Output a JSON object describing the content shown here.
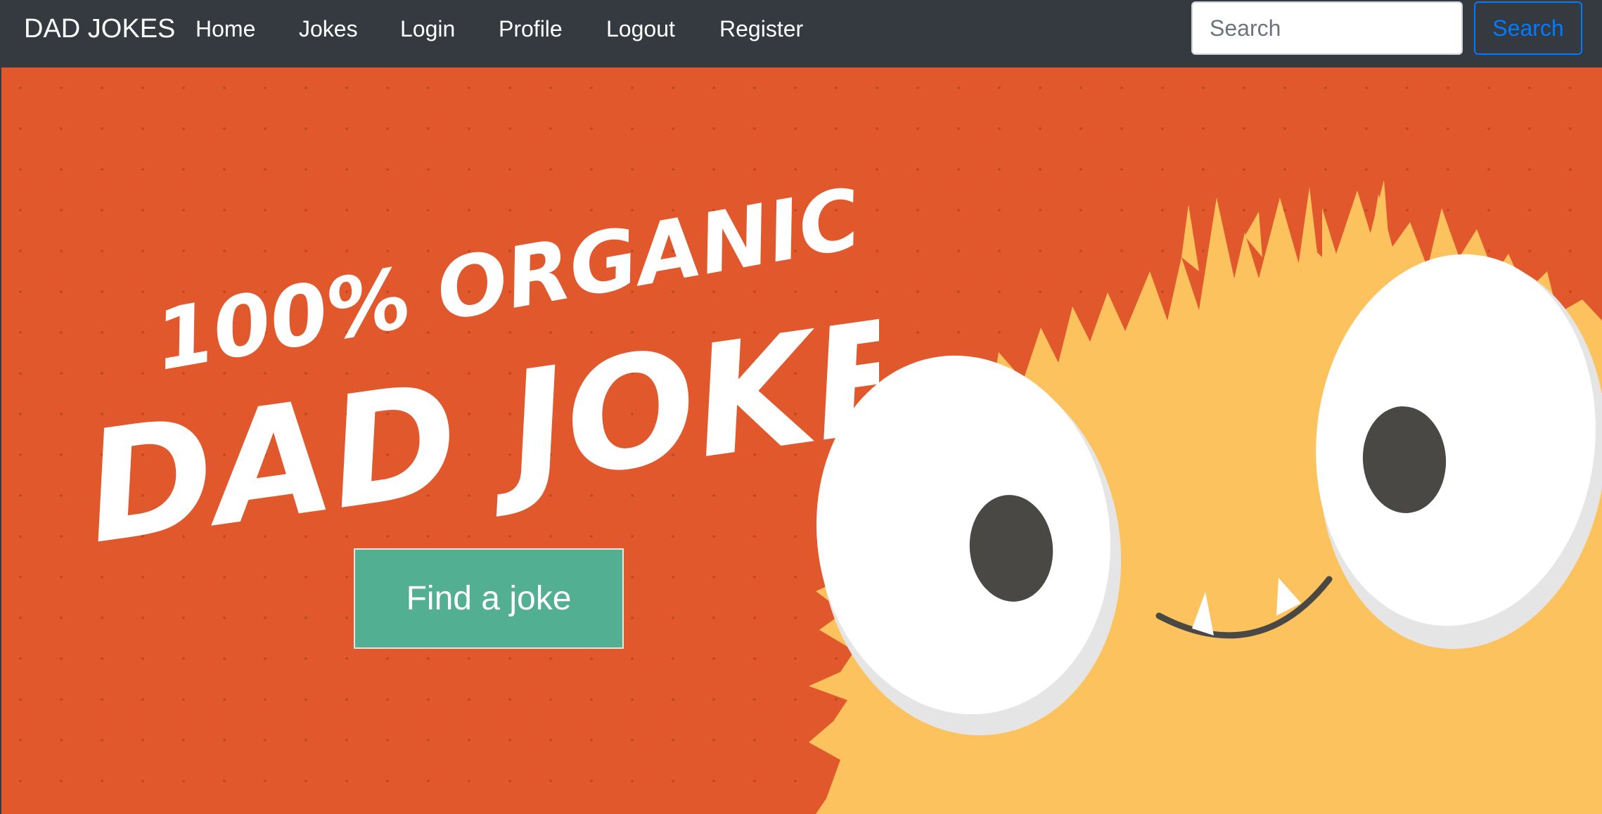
{
  "navbar": {
    "brand": "DAD JOKES",
    "links": [
      "Home",
      "Jokes",
      "Login",
      "Profile",
      "Logout",
      "Register"
    ],
    "search": {
      "placeholder": "Search",
      "button_label": "Search"
    }
  },
  "hero": {
    "headline_line1": "100% ORGANIC",
    "headline_line2": "DAD JOKES!",
    "cta_label": "Find a joke"
  },
  "colors": {
    "navbar_bg": "#343a40",
    "hero_bg": "#e0582c",
    "cta_bg": "#52af91",
    "search_accent": "#007bff",
    "monster_fur": "#fcc25e",
    "monster_pupil": "#4a4844"
  }
}
